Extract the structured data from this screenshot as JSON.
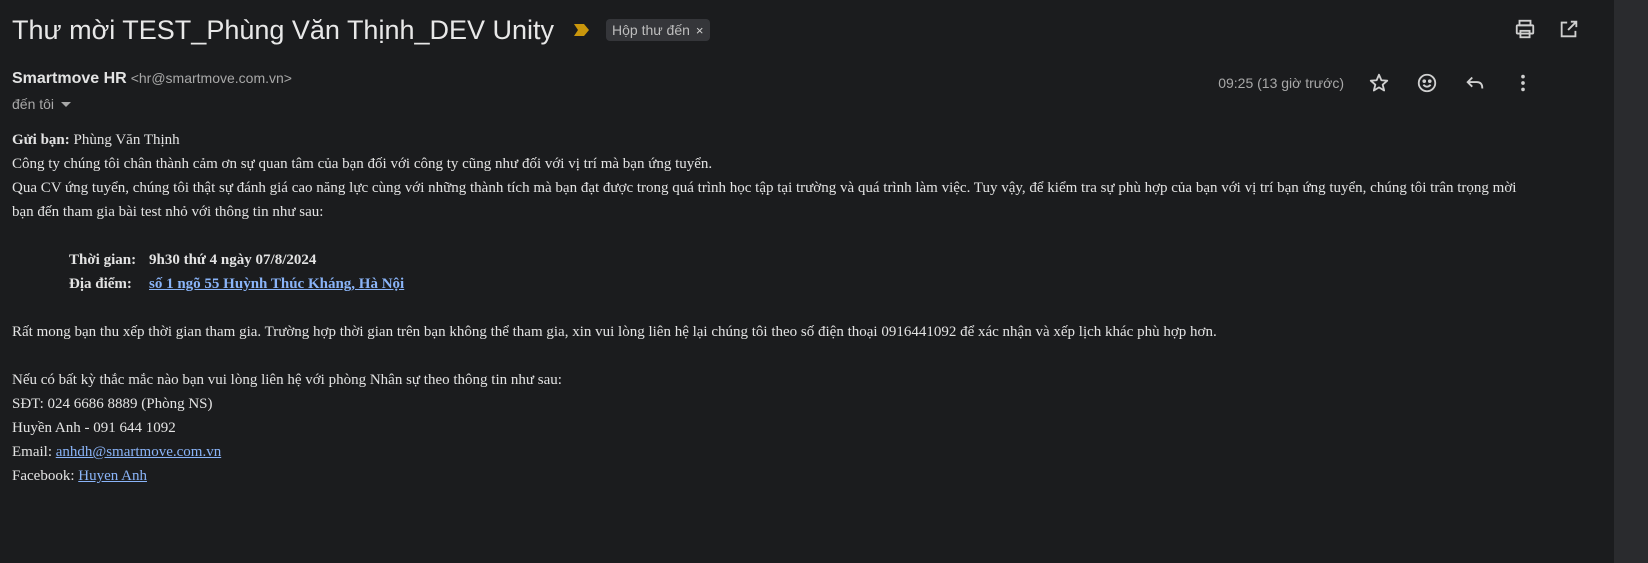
{
  "header": {
    "subject": "Thư mời TEST_Phùng Văn Thịnh_DEV Unity",
    "label": "Hộp thư đến",
    "label_remove": "×",
    "importance_color": "#c9960c",
    "icons": [
      "print-icon",
      "open-in-new-window-icon"
    ]
  },
  "sender": {
    "name": "Smartmove HR",
    "email": "<hr@smartmove.com.vn>",
    "to": "đến tôi",
    "timestamp": "09:25 (13 giờ trước)",
    "icons": [
      "star-icon",
      "emoji-icon",
      "reply-icon",
      "more-vert-icon"
    ]
  },
  "body": {
    "greeting_label": "Gửi bạn:",
    "greeting_name": " Phùng Văn Thịnh",
    "para1": "Công ty chúng tôi chân thành cảm ơn sự quan tâm của bạn đối với công ty cũng như đối với vị trí mà bạn ứng tuyển.",
    "para2": "Qua CV ứng tuyển, chúng tôi thật sự đánh giá cao năng lực cùng với những thành tích mà bạn đạt được trong quá trình học tập tại trường và quá trình làm việc. Tuy vậy, để kiểm tra sự phù hợp của bạn với vị trí bạn ứng tuyển, chúng tôi trân trọng mời bạn đến tham gia bài test nhỏ với thông tin như sau:",
    "time_label": "Thời gian:",
    "time_value": "9h30 thứ 4 ngày 07/8/2024",
    "place_label": "Địa điểm:",
    "place_value": "số 1 ngõ 55 Huỳnh Thúc Kháng, Hà Nội",
    "para3": "Rất mong bạn thu xếp thời gian tham gia. Trường hợp thời gian trên bạn không thể tham gia, xin vui lòng liên hệ lại chúng tôi theo số điện thoại 0916441092 để xác nhận và xếp lịch khác phù hợp hơn.",
    "para4": "Nếu có bất kỳ thắc mắc nào bạn  vui lòng liên hệ với phòng Nhân sự theo thông tin như sau:",
    "phone": "SĐT: 024 6686 8889 (Phòng NS)",
    "contact": "Huyền Anh - 091 644 1092",
    "email_label": "Email: ",
    "email_value": "anhdh@smartmove.com.vn",
    "facebook_label": "Facebook: ",
    "facebook_value": "Huyen Anh"
  }
}
